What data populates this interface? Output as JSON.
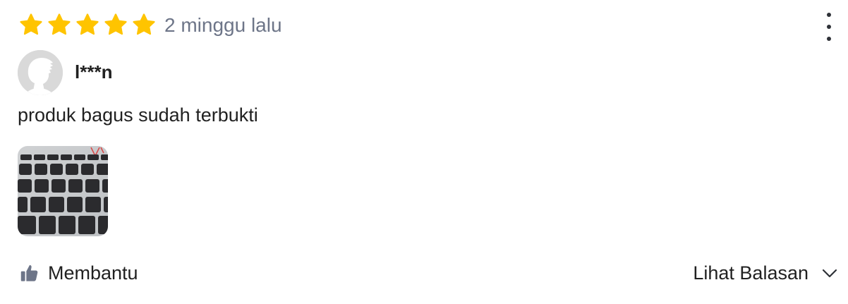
{
  "review": {
    "rating": 5,
    "rating_max": 5,
    "star_color": "#ffc400",
    "time_ago": "2 minggu lalu",
    "user": {
      "name": "l***n",
      "avatar_icon": "default-user-avatar-icon"
    },
    "text": "produk bagus sudah terbukti",
    "photo_count": 1,
    "menu_icon": "more-vertical-icon"
  },
  "actions": {
    "helpful_label": "Membantu",
    "helpful_icon": "thumbs-up-icon",
    "replies_label": "Lihat Balasan",
    "replies_icon": "chevron-down-icon"
  }
}
